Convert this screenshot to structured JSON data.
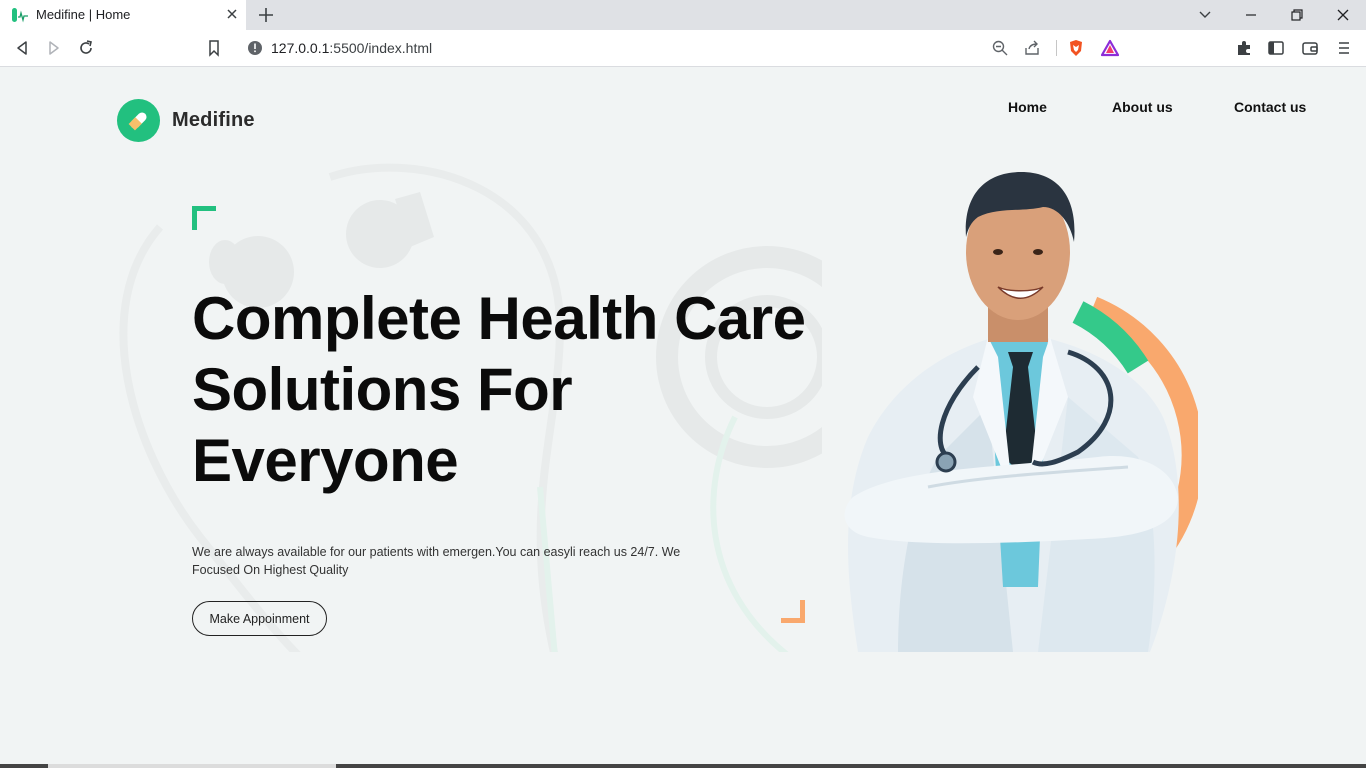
{
  "browser": {
    "tab_title": "Medifine | Home",
    "url_host": "127.0.0.1",
    "url_rest": ":5500/index.html"
  },
  "site": {
    "brand": "Medifine",
    "nav": [
      {
        "label": "Home"
      },
      {
        "label": "About us"
      },
      {
        "label": "Contact us"
      }
    ]
  },
  "hero": {
    "headline": [
      "Complete Health Care",
      "Solutions For",
      "Everyone"
    ],
    "subtext": "We are always available for our patients with emergen.You can easyli reach us 24/7. We Focused On Highest Quality",
    "cta_label": "Make Appoinment"
  },
  "colors": {
    "brand_green": "#22c07f",
    "accent_orange": "#f9a86d",
    "page_bg": "#f1f4f4"
  }
}
